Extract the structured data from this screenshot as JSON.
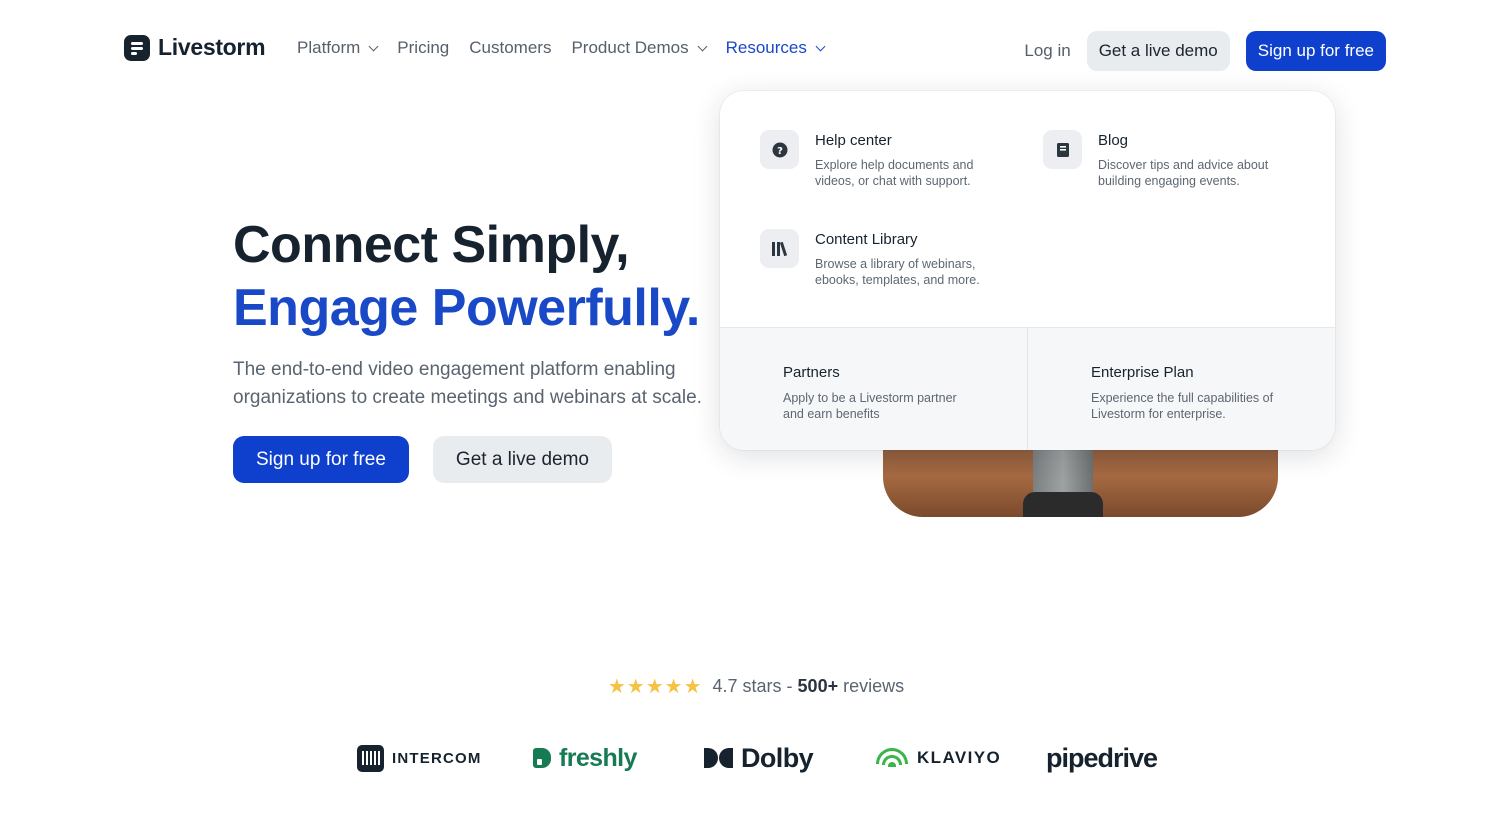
{
  "header": {
    "logo": "Livestorm",
    "nav": [
      {
        "label": "Platform",
        "has_menu": true
      },
      {
        "label": "Pricing",
        "has_menu": false
      },
      {
        "label": "Customers",
        "has_menu": false
      },
      {
        "label": "Product Demos",
        "has_menu": true
      },
      {
        "label": "Resources",
        "has_menu": true,
        "active": true
      }
    ],
    "login": "Log in",
    "demo_button": "Get a live demo",
    "signup_button": "Sign up for free"
  },
  "hero": {
    "title_line1": "Connect Simply,",
    "title_line2": "Engage Powerfully.",
    "subtitle": "The end-to-end video engagement platform enabling organizations to create meetings and webinars at scale.",
    "cta_primary": "Sign up for free",
    "cta_secondary": "Get a live demo"
  },
  "resources_menu": {
    "items": [
      {
        "title": "Help center",
        "desc": "Explore help documents and videos, or chat with support.",
        "icon": "question-icon"
      },
      {
        "title": "Blog",
        "desc": "Discover tips and advice about building engaging events.",
        "icon": "book-icon"
      },
      {
        "title": "Content Library",
        "desc": "Browse a library of webinars, ebooks, templates, and more.",
        "icon": "library-icon"
      }
    ],
    "footer": [
      {
        "title": "Partners",
        "desc": "Apply to be a Livestorm partner and earn benefits"
      },
      {
        "title": "Enterprise Plan",
        "desc": "Experience the full capabilities of Livestorm for enterprise."
      }
    ]
  },
  "reviews": {
    "stars": "★★★★★",
    "rating_text": "4.7 stars - ",
    "count": "500+",
    "suffix": "reviews"
  },
  "logos": [
    "INTERCOM",
    "freshly",
    "Dolby",
    "KLAVIYO",
    "pipedrive"
  ],
  "colors": {
    "brand_blue": "#0e3fcd",
    "accent_blue": "#1a49c7",
    "star": "#f6c243",
    "freshly_green": "#167a53",
    "klaviyo_green": "#39b54a"
  }
}
